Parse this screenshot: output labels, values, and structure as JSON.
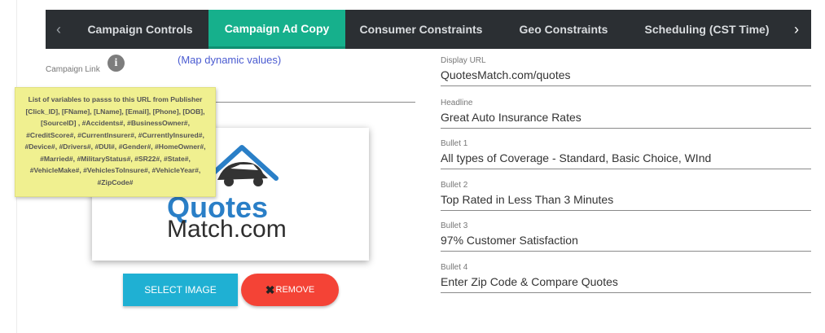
{
  "tabs": {
    "left_arrow": "‹",
    "right_arrow": "›",
    "items": [
      "Campaign Controls",
      "Campaign Ad Copy",
      "Consumer Constraints",
      "Geo Constraints",
      "Scheduling (CST Time)"
    ],
    "active": "Campaign Ad Copy"
  },
  "campaign_link": {
    "label": "Campaign Link",
    "info_icon_glyph": "i",
    "map_link": "(Map dynamic values)",
    "value": ""
  },
  "tooltip": {
    "text": "List of variables to passs to this URL from Publisher [Click_ID], [FName], [LName], [Email], [Phone], [DOB], [SourceID] , #Accidents#, #BusinessOwner#, #CreditScore#, #CurrentInsurer#, #CurrentlyInsured#, #Device#, #Drivers#, #DUI#, #Gender#, #HomeOwner#, #Married#, #MilitaryStatus#, #SR22#, #State#, #VehicleMake#, #VehiclesToInsure#, #VehicleYear#, #ZipCode#"
  },
  "image": {
    "logo_line1": "Quotes",
    "logo_line2": "Match.com"
  },
  "buttons": {
    "select_image": "SELECT IMAGE",
    "remove_icon": "✖",
    "remove": "REMOVE"
  },
  "fields": [
    {
      "label": "Display URL",
      "value": "QuotesMatch.com/quotes"
    },
    {
      "label": "Headline",
      "value": "Great Auto Insurance Rates"
    },
    {
      "label": "Bullet 1",
      "value": "All types of Coverage - Standard, Basic Choice, WInd"
    },
    {
      "label": "Bullet 2",
      "value": "Top Rated in Less Than 3 Minutes"
    },
    {
      "label": "Bullet 3",
      "value": "97% Customer Satisfaction"
    },
    {
      "label": "Bullet 4",
      "value": "Enter Zip Code & Compare Quotes"
    }
  ],
  "colors": {
    "tab_bg": "#2b2f33",
    "tab_active": "#16b08c",
    "tooltip_bg": "#f0f090",
    "select_button": "#1fb0d3",
    "remove_button": "#f44336",
    "link": "#4a5bd1"
  }
}
